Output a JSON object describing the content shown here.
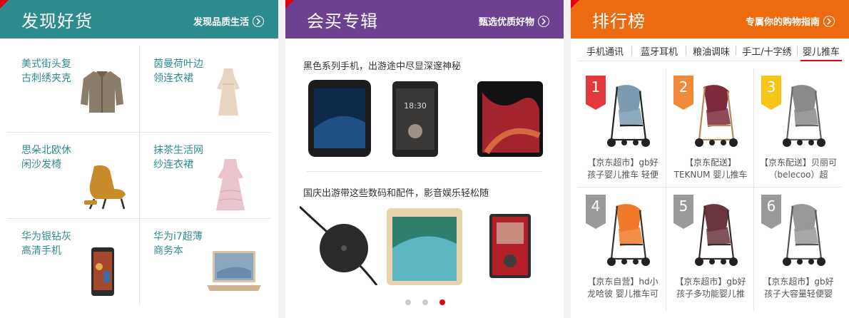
{
  "discover": {
    "title": "发现好货",
    "more": "发现品质生活",
    "items": [
      {
        "line1": "美式街头复",
        "line2": "古刺绣夹克",
        "icon": "jacket-image"
      },
      {
        "line1": "茵曼荷叶边",
        "line2": "领连衣裙",
        "icon": "dress-image"
      },
      {
        "line1": "思朵北欧休",
        "line2": "闲沙发椅",
        "icon": "armchair-image"
      },
      {
        "line1": "抹茶生活网",
        "line2": "纱连衣裙",
        "icon": "pink-dress-image"
      },
      {
        "line1": "华为银钻灰",
        "line2": "高清手机",
        "icon": "phone-image"
      },
      {
        "line1": "华为i7超薄",
        "line2": "商务本",
        "icon": "laptop-image"
      }
    ]
  },
  "special": {
    "title": "会买专辑",
    "more": "甄选优质好物",
    "caption1": "黑色系列手机，出游途中尽显深邃神秘",
    "caption2": "国庆出游带这些数码和配件，影音娱乐轻松随",
    "dots": 3,
    "active_dot": 3
  },
  "ranking": {
    "title": "排行榜",
    "more": "专属你的购物指南",
    "tabs": [
      "手机通讯",
      "蓝牙耳机",
      "粮油调味",
      "手工/十字绣",
      "婴儿推车"
    ],
    "active_tab": "婴儿推车",
    "items": [
      {
        "rank": "1",
        "name": "【京东超市】gb好孩子婴儿推车 轻便",
        "color": "#e4393c"
      },
      {
        "rank": "2",
        "name": "【京东配送】TEKNUM 婴儿推车高",
        "color": "#f08a3a"
      },
      {
        "rank": "3",
        "name": "【京东配送】贝丽可（belecoo）超",
        "color": "#f5c518"
      },
      {
        "rank": "4",
        "name": "【京东自营】hd小龙哈彼 婴儿推车可",
        "color": "#9a9a9a"
      },
      {
        "rank": "5",
        "name": "【京东超市】gb好孩子多功能婴儿推",
        "color": "#9a9a9a"
      },
      {
        "rank": "6",
        "name": "【京东超市】gb好孩子大容量轻便婴",
        "color": "#9a9a9a"
      }
    ]
  }
}
